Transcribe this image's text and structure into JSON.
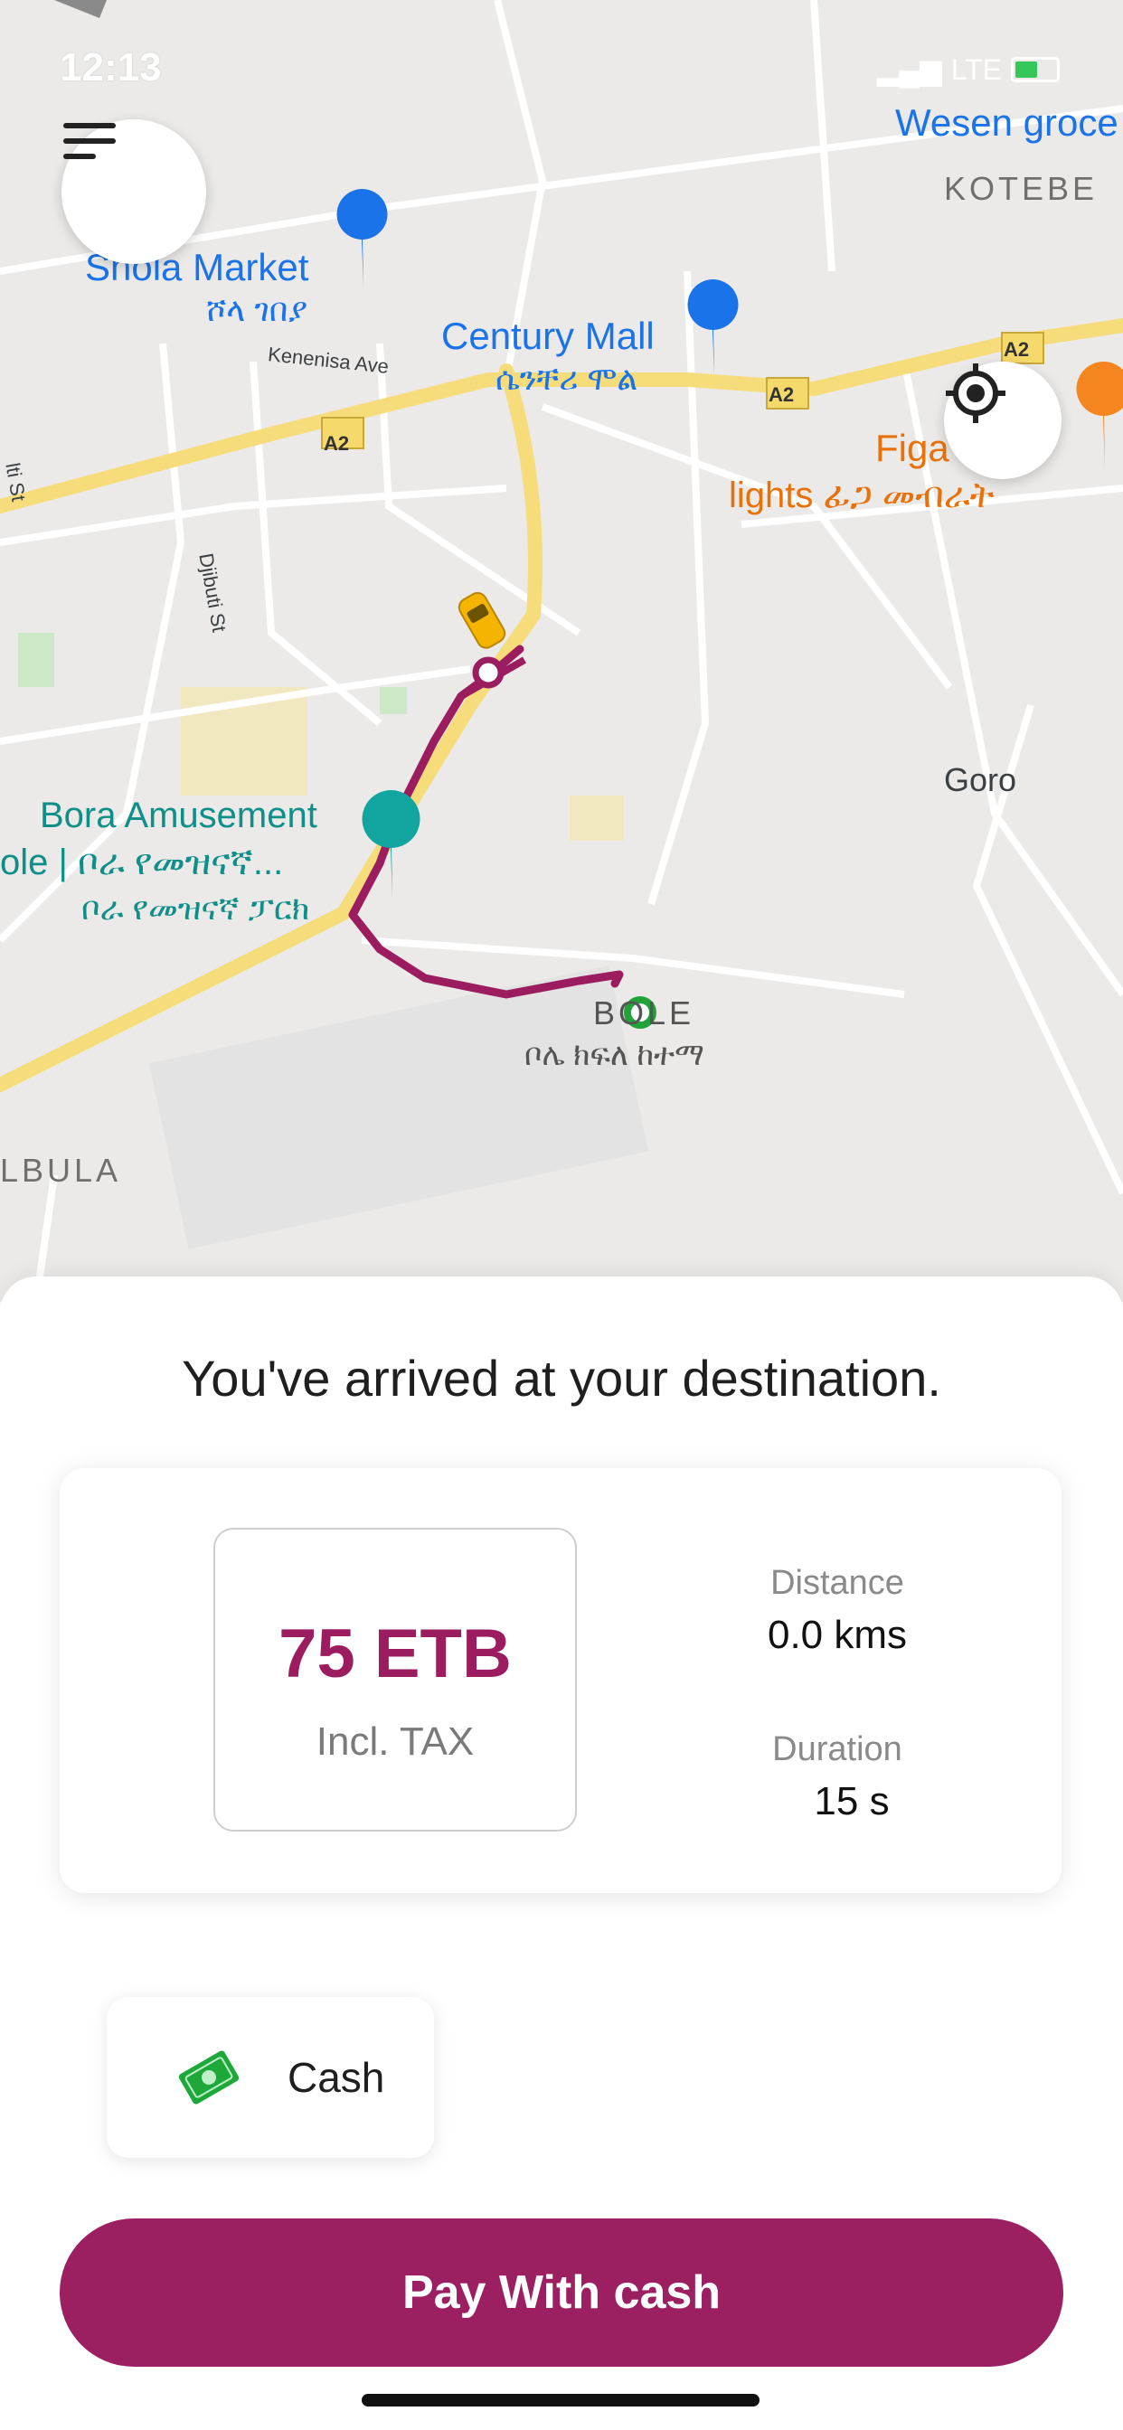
{
  "status_bar": {
    "time": "12:13",
    "network": "LTE"
  },
  "map": {
    "labels": {
      "wesen": "Wesen groce",
      "kotebe": "KOTEBE",
      "shola_en": "Shola Market",
      "shola_am": "ሾላ ገበያ",
      "century_en": "Century Mall",
      "century_am": "ሴንቸሪ ሞል",
      "kenenisa": "Kenenisa Ave",
      "a2": "A2",
      "figa_en": "Figa",
      "lights_am": "lights ፊጋ መብራት",
      "djibuti": "Djibuti St",
      "goro": "Goro",
      "bora_en": "Bora Amusement",
      "bora_am1": "ole | ቦራ የመዝናኛ...",
      "bora_am2": "ቦራ የመዝናኛ ፓርክ",
      "bole_en": "BOLE",
      "bole_am": "ቦሌ ክፍለ ከተማ",
      "albula": "LBULA",
      "lti_st": "lti St"
    },
    "route_color": "#9b1d5f"
  },
  "sheet": {
    "title": "You've arrived at your destination.",
    "price": "75 ETB",
    "price_note": "Incl. TAX",
    "distance_label": "Distance",
    "distance_value": "0.0 kms",
    "duration_label": "Duration",
    "duration_value": "15 s",
    "payment_method": "Cash",
    "pay_button": "Pay With cash"
  },
  "colors": {
    "accent": "#9c1f62",
    "price": "#9b1d5f",
    "cash_icon": "#1fa83a"
  }
}
